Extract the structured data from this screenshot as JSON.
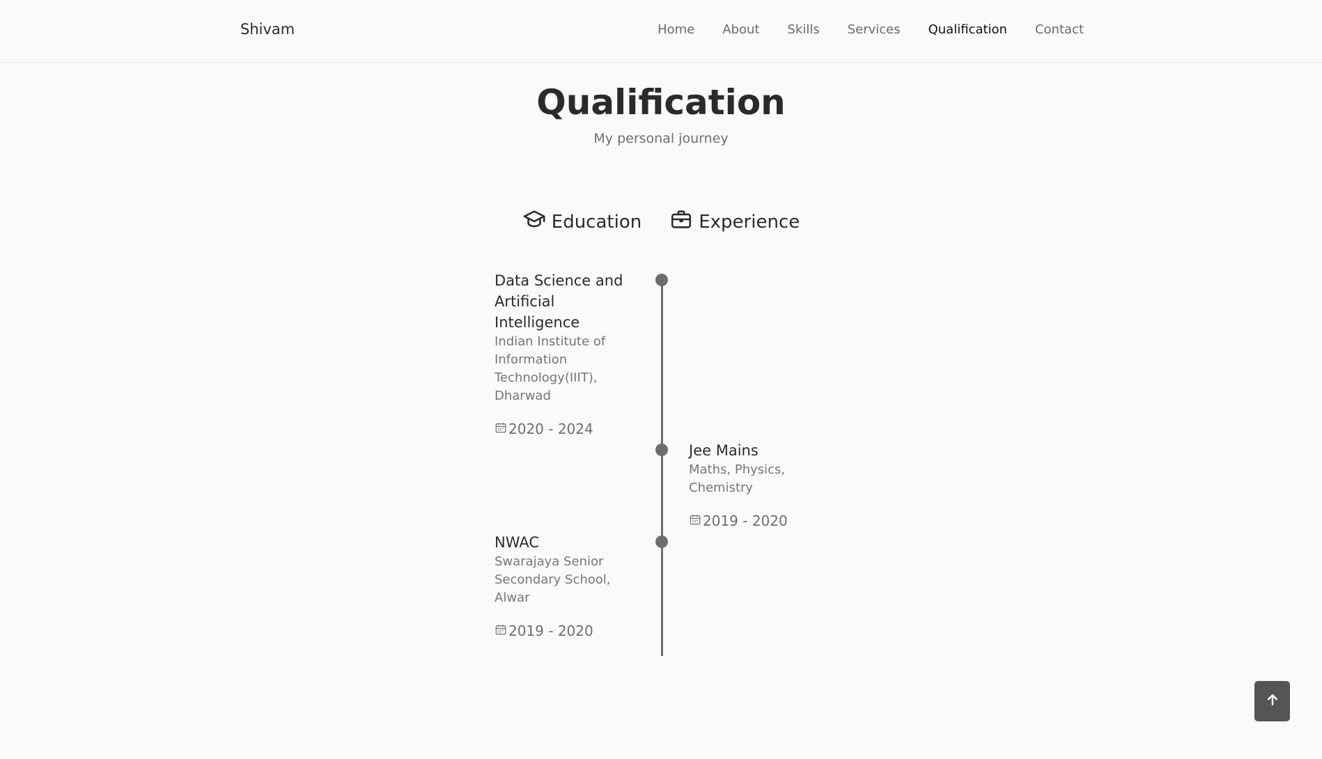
{
  "nav": {
    "brand": "Shivam",
    "links": [
      "Home",
      "About",
      "Skills",
      "Services",
      "Qualification",
      "Contact"
    ],
    "active": "Qualification"
  },
  "section": {
    "title": "Qualification",
    "subtitle": "My personal journey"
  },
  "tabs": {
    "education_label": "Education",
    "experience_label": "Experience"
  },
  "timeline": [
    {
      "title": "Data Science and Artificial Intelligence",
      "subtitle": "Indian Institute of Information Technology(IIIT), Dharwad",
      "date": "2020 - 2024"
    },
    {
      "title": "Jee Mains",
      "subtitle": "Maths, Physics, Chemistry",
      "date": "2019 - 2020"
    },
    {
      "title": "NWAC",
      "subtitle": "Swarajaya Senior Secondary School, Alwar",
      "date": "2019 - 2020"
    }
  ],
  "icons": {
    "education": "graduation-cap-icon",
    "experience": "briefcase-icon",
    "date": "calendar-icon",
    "scroll_up": "arrow-up-icon"
  }
}
